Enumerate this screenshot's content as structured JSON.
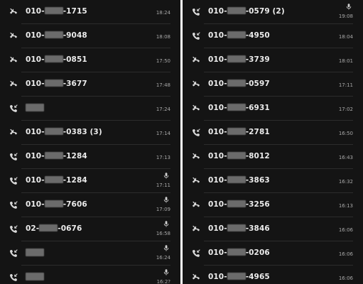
{
  "left": {
    "rows": [
      {
        "type": "missed",
        "pre": "010-",
        "post": "-1715",
        "time": "18:24",
        "mic": false
      },
      {
        "type": "missed",
        "pre": "010-",
        "post": "-9048",
        "time": "18:08",
        "mic": false
      },
      {
        "type": "missed",
        "pre": "010-",
        "post": "-0851",
        "time": "17:50",
        "mic": false
      },
      {
        "type": "missed",
        "pre": "010-",
        "post": "-3677",
        "time": "17:48",
        "mic": false
      },
      {
        "type": "incoming",
        "pre": "",
        "post": "",
        "time": "17:24",
        "mic": false
      },
      {
        "type": "missed",
        "pre": "010-",
        "post": "-0383 (3)",
        "time": "17:14",
        "mic": false
      },
      {
        "type": "incoming",
        "pre": "010-",
        "post": "-1284",
        "time": "17:13",
        "mic": false
      },
      {
        "type": "incoming",
        "pre": "010-",
        "post": "-1284",
        "time": "17:11",
        "mic": true
      },
      {
        "type": "incoming",
        "pre": "010-",
        "post": "-7606",
        "time": "17:09",
        "mic": true
      },
      {
        "type": "incoming",
        "pre": "02-",
        "post": "-0676",
        "time": "16:58",
        "mic": true
      },
      {
        "type": "incoming",
        "pre": "",
        "post": "",
        "time": "16:24",
        "mic": true
      },
      {
        "type": "incoming",
        "pre": "",
        "post": "",
        "time": "16:2?",
        "mic": true
      }
    ]
  },
  "right": {
    "rows": [
      {
        "type": "incoming",
        "pre": "010-",
        "post": "-0579 (2)",
        "time": "19:08",
        "mic": true
      },
      {
        "type": "incoming",
        "pre": "010-",
        "post": "-4950",
        "time": "18:04",
        "mic": false
      },
      {
        "type": "missed",
        "pre": "010-",
        "post": "-3739",
        "time": "18:01",
        "mic": false
      },
      {
        "type": "missed",
        "pre": "010-",
        "post": "-0597",
        "time": "17:11",
        "mic": false
      },
      {
        "type": "missed",
        "pre": "010-",
        "post": "-6931",
        "time": "17:02",
        "mic": false
      },
      {
        "type": "incoming",
        "pre": "010-",
        "post": "-2781",
        "time": "16:50",
        "mic": false
      },
      {
        "type": "missed",
        "pre": "010-",
        "post": "-8012",
        "time": "16:43",
        "mic": false
      },
      {
        "type": "missed",
        "pre": "010-",
        "post": "-3863",
        "time": "16:32",
        "mic": false
      },
      {
        "type": "missed",
        "pre": "010-",
        "post": "-3256",
        "time": "16:13",
        "mic": false
      },
      {
        "type": "missed",
        "pre": "010-",
        "post": "-3846",
        "time": "16:06",
        "mic": false
      },
      {
        "type": "incoming",
        "pre": "010-",
        "post": "-0206",
        "time": "16:06",
        "mic": false
      },
      {
        "type": "missed",
        "pre": "010-",
        "post": "-4965",
        "time": "16:06",
        "mic": false
      }
    ]
  },
  "icons": {
    "missed": "missed-call-icon",
    "incoming": "incoming-call-icon",
    "mic": "voice-recording-icon"
  },
  "colors": {
    "background": "#141414",
    "text": "#ececec",
    "time": "#a8a8a8",
    "separator": "#2c2c2c"
  }
}
